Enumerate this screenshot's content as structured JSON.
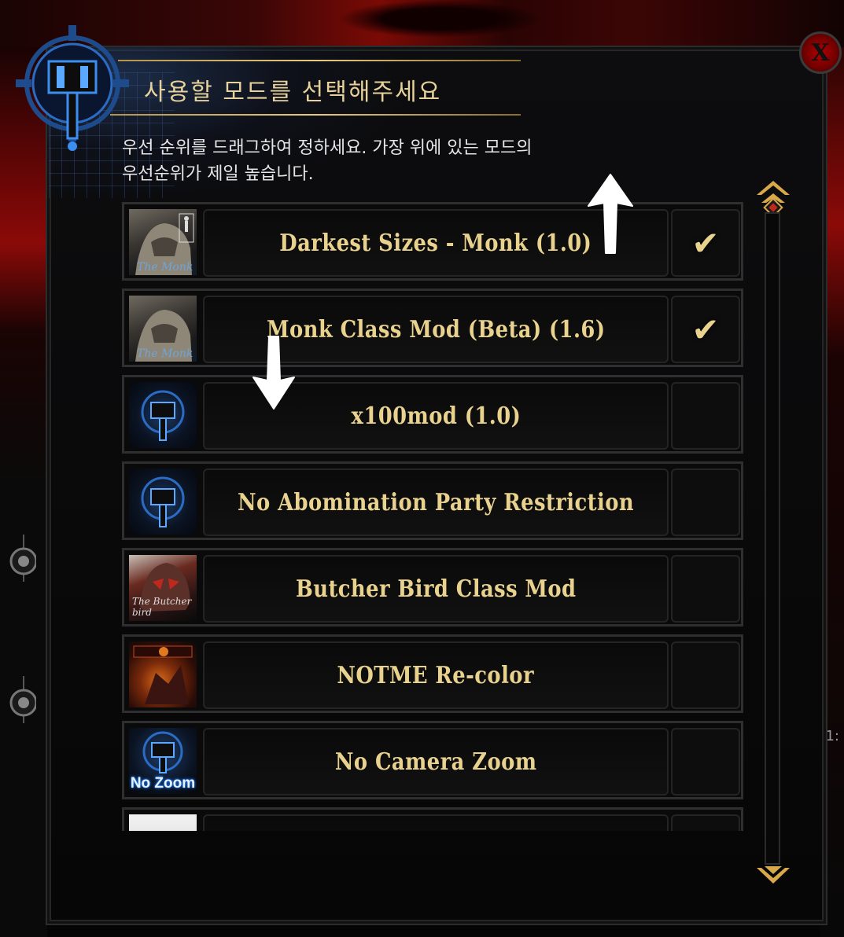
{
  "dialog": {
    "title": "사용할 모드를 선택해주세요",
    "subtitle_line1": "우선 순위를 드래그하여 정하세요. 가장 위에 있는 모드의",
    "subtitle_line2": "우선순위가 제일 높습니다.",
    "close_label": "X"
  },
  "mods": [
    {
      "name": "Darkest Sizes - Monk (1.0)",
      "enabled": true,
      "thumb_text": "The Monk"
    },
    {
      "name": "Monk Class Mod (Beta) (1.6)",
      "enabled": true,
      "thumb_text": "The Monk"
    },
    {
      "name": "x100mod (1.0)",
      "enabled": false
    },
    {
      "name": "No Abomination Party Restriction",
      "enabled": false
    },
    {
      "name": "Butcher Bird Class Mod",
      "enabled": false,
      "thumb_text": "The Butcher bird"
    },
    {
      "name": "NOTME Re-color",
      "enabled": false
    },
    {
      "name": "No Camera Zoom",
      "enabled": false,
      "thumb_text": "No Zoom"
    },
    {
      "name": "",
      "enabled": false
    }
  ],
  "check_glyph": "✔",
  "side_text": "1:",
  "icons": {
    "scroll_up": "chevron-up-icon",
    "scroll_down": "chevron-down-icon",
    "emblem": "hammer-emblem-icon",
    "close": "close-icon"
  },
  "colors": {
    "title_gold": "#e6d29a",
    "mod_name_gold": "#e8d28e",
    "close_red": "#b30000",
    "accent_blue": "#1c7cff"
  }
}
